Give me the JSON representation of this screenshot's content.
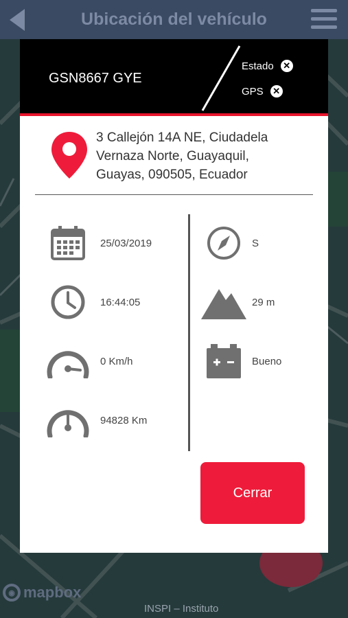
{
  "header": {
    "title": "Ubicación del vehículo"
  },
  "vehicle": {
    "plate": "GSN8667 GYE"
  },
  "status_links": [
    {
      "label": "Estado"
    },
    {
      "label": "GPS"
    }
  ],
  "address": "3 Callejón 14A NE, Ciudadela Vernaza Norte, Guayaquil, Guayas, 090505, Ecuador",
  "info_left": {
    "date": "25/03/2019",
    "time": "16:44:05",
    "speed": "0 Km/h",
    "odometer": "94828 Km"
  },
  "info_right": {
    "heading": "S",
    "altitude": "29 m",
    "battery": "Bueno"
  },
  "close_label": "Cerrar",
  "map": {
    "logo_text": "mapbox",
    "footer_text": "INSPI – Instituto"
  },
  "colors": {
    "accent": "#ee1c3a",
    "header_bg": "#000000",
    "icon_gray": "#707070"
  }
}
